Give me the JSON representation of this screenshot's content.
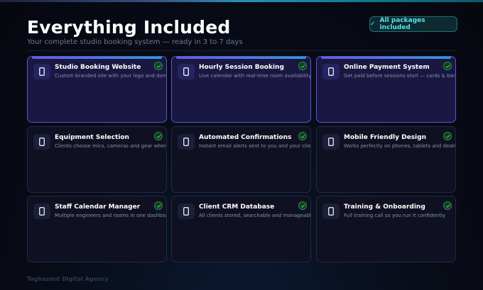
{
  "header": {
    "title": "Everything Included",
    "subtitle": "Your complete studio booking system — ready in 3 to 7 days"
  },
  "badge": {
    "check": "✓",
    "label": "All packages included"
  },
  "features": [
    {
      "name": "Studio Booking Website",
      "desc": "Custom branded site with your logo and domain",
      "icon": "phone-icon",
      "highlighted": true
    },
    {
      "name": "Hourly Session Booking",
      "desc": "Live calendar with real-time room availability",
      "icon": "phone-icon",
      "highlighted": true
    },
    {
      "name": "Online Payment System",
      "desc": "Get paid before sessions start — cards & bank",
      "icon": "phone-icon",
      "highlighted": true
    },
    {
      "name": "Equipment Selection",
      "desc": "Clients choose mics, cameras and gear when booking",
      "icon": "phone-icon",
      "highlighted": false
    },
    {
      "name": "Automated Confirmations",
      "desc": "Instant email alerts sent to you and your client",
      "icon": "phone-icon",
      "highlighted": false
    },
    {
      "name": "Mobile Friendly Design",
      "desc": "Works perfectly on phones, tablets and desktop",
      "icon": "phone-icon",
      "highlighted": false
    },
    {
      "name": "Staff Calendar Manager",
      "desc": "Multiple engineers and rooms in one dashboard",
      "icon": "phone-icon",
      "highlighted": false
    },
    {
      "name": "Client CRM Database",
      "desc": "All clients stored, searchable and manageable",
      "icon": "phone-icon",
      "highlighted": false
    },
    {
      "name": "Training & Onboarding",
      "desc": "Full training call so you run it confidently",
      "icon": "phone-icon",
      "highlighted": false
    }
  ],
  "footer": {
    "brand": "Taghazout Digital Agency"
  },
  "colors": {
    "accent": "#5fe0e8",
    "highlight_border": "#5b55d6",
    "check_green": "#3fbf5f"
  }
}
